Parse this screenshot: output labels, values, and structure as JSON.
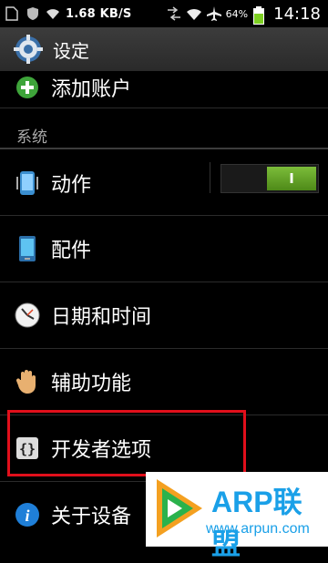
{
  "status_bar": {
    "net_speed": "1.68 KB/S",
    "battery_pct": "64%",
    "time": "14:18",
    "icons": [
      "sim-card-icon",
      "shield-icon",
      "wifi-icon",
      "data-arrows-icon",
      "wifi-icon",
      "airplane-icon",
      "battery-icon"
    ]
  },
  "title_bar": {
    "title": "设定",
    "icon": "settings-gear-icon"
  },
  "items_top": [
    {
      "label": "添加账户",
      "icon": "plus-circle-icon"
    }
  ],
  "section": {
    "label": "系统"
  },
  "items": [
    {
      "label": "动作",
      "icon": "phone-motion-icon",
      "toggle": {
        "state": "I",
        "on": true
      }
    },
    {
      "label": "配件",
      "icon": "phone-device-icon"
    },
    {
      "label": "日期和时间",
      "icon": "clock-icon"
    },
    {
      "label": "辅助功能",
      "icon": "hand-icon"
    },
    {
      "label": "开发者选项",
      "icon": "braces-icon",
      "highlighted": true
    },
    {
      "label": "关于设备",
      "icon": "info-icon"
    }
  ],
  "watermark": {
    "brand": "ARP联盟",
    "url": "www.arpun.com",
    "logo": "play-logo-icon"
  },
  "colors": {
    "accent_green": "#5c9e22",
    "highlight_red": "#e10f1b",
    "brand_blue": "#1aa0e8"
  }
}
